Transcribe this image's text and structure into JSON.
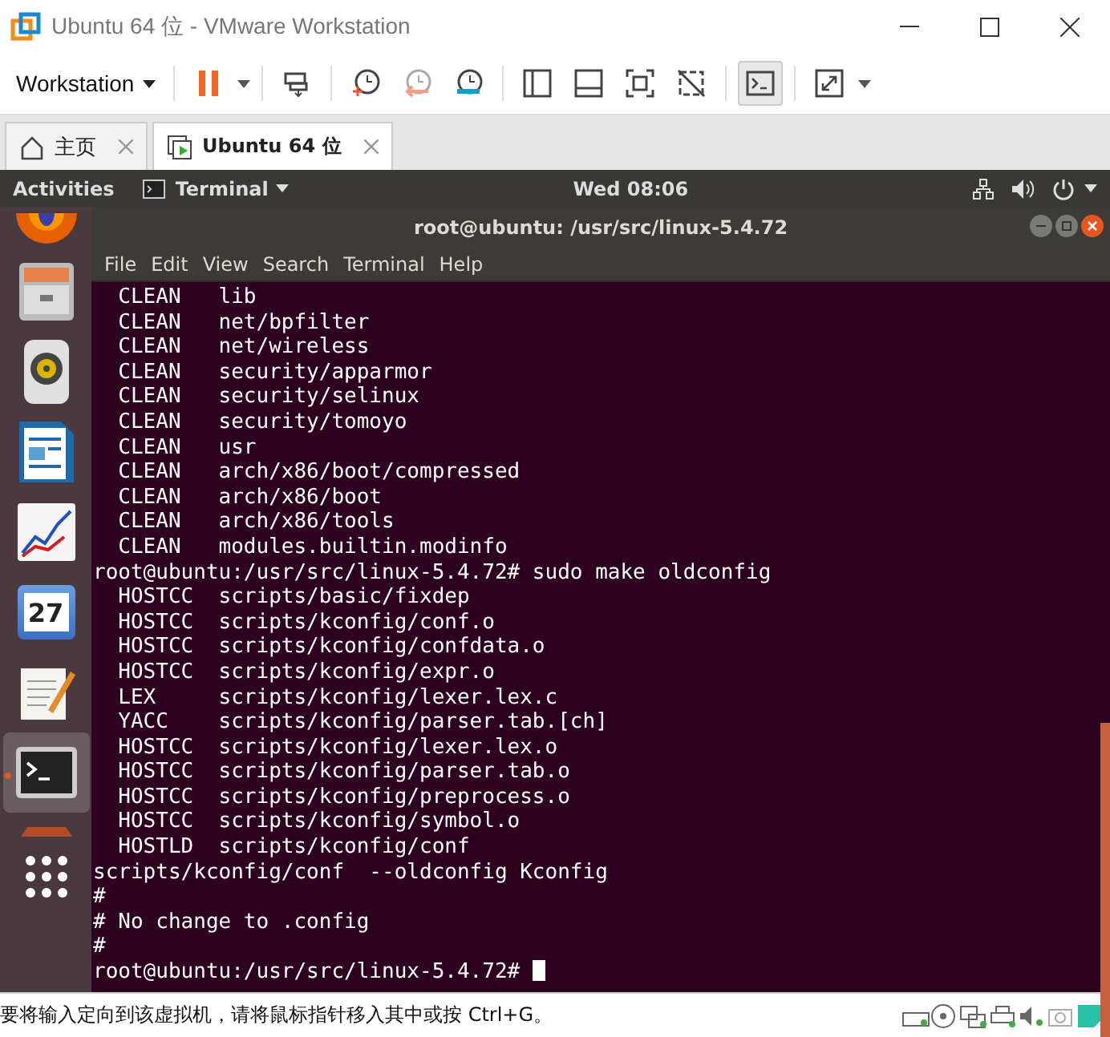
{
  "window": {
    "title": "Ubuntu 64 位 - VMware Workstation"
  },
  "toolbar": {
    "menu": "Workstation",
    "buttons": [
      {
        "kind": "pause",
        "selected": false
      },
      {
        "kind": "send-keys",
        "selected": false
      },
      {
        "kind": "snapshot-take",
        "selected": false
      },
      {
        "kind": "snapshot-revert",
        "selected": false
      },
      {
        "kind": "snapshot-manage",
        "selected": false
      },
      {
        "kind": "view-library",
        "selected": false
      },
      {
        "kind": "view-thumbnail",
        "selected": false
      },
      {
        "kind": "view-fullscreen",
        "selected": false
      },
      {
        "kind": "view-unity",
        "selected": false
      },
      {
        "kind": "view-console",
        "selected": true
      },
      {
        "kind": "stretch",
        "selected": false
      }
    ]
  },
  "tabs": [
    {
      "label": "主页",
      "kind": "home",
      "selected": false
    },
    {
      "label": "Ubuntu 64 位",
      "kind": "vm",
      "selected": true
    }
  ],
  "top_bar": {
    "activities": "Activities",
    "app_menu": "Terminal",
    "clock": "Wed 08:06"
  },
  "dock": {
    "items": [
      {
        "kind": "firefox",
        "selected": false
      },
      {
        "kind": "files",
        "selected": false
      },
      {
        "kind": "speaker",
        "selected": false
      },
      {
        "kind": "writer",
        "selected": false
      },
      {
        "kind": "chart",
        "selected": false
      },
      {
        "kind": "calendar",
        "label": "27",
        "selected": false
      },
      {
        "kind": "editor",
        "selected": false
      },
      {
        "kind": "terminal",
        "selected": true
      },
      {
        "kind": "partial",
        "selected": false
      },
      {
        "kind": "apps",
        "selected": false
      }
    ]
  },
  "terminal": {
    "title": "root@ubuntu: /usr/src/linux-5.4.72",
    "menu": [
      "File",
      "Edit",
      "View",
      "Search",
      "Terminal",
      "Help"
    ],
    "lines": [
      "  CLEAN   lib",
      "  CLEAN   net/bpfilter",
      "  CLEAN   net/wireless",
      "  CLEAN   security/apparmor",
      "  CLEAN   security/selinux",
      "  CLEAN   security/tomoyo",
      "  CLEAN   usr",
      "  CLEAN   arch/x86/boot/compressed",
      "  CLEAN   arch/x86/boot",
      "  CLEAN   arch/x86/tools",
      "  CLEAN   modules.builtin.modinfo",
      "root@ubuntu:/usr/src/linux-5.4.72# sudo make oldconfig",
      "  HOSTCC  scripts/basic/fixdep",
      "  HOSTCC  scripts/kconfig/conf.o",
      "  HOSTCC  scripts/kconfig/confdata.o",
      "  HOSTCC  scripts/kconfig/expr.o",
      "  LEX     scripts/kconfig/lexer.lex.c",
      "  YACC    scripts/kconfig/parser.tab.[ch]",
      "  HOSTCC  scripts/kconfig/lexer.lex.o",
      "  HOSTCC  scripts/kconfig/parser.tab.o",
      "  HOSTCC  scripts/kconfig/preprocess.o",
      "  HOSTCC  scripts/kconfig/symbol.o",
      "  HOSTLD  scripts/kconfig/conf",
      "scripts/kconfig/conf  --oldconfig Kconfig",
      "#",
      "# No change to .config",
      "#"
    ],
    "prompt": "root@ubuntu:/usr/src/linux-5.4.72# "
  },
  "status_bar": {
    "message": "要将输入定向到该虚拟机，请将鼠标指针移入其中或按 Ctrl+G。"
  }
}
